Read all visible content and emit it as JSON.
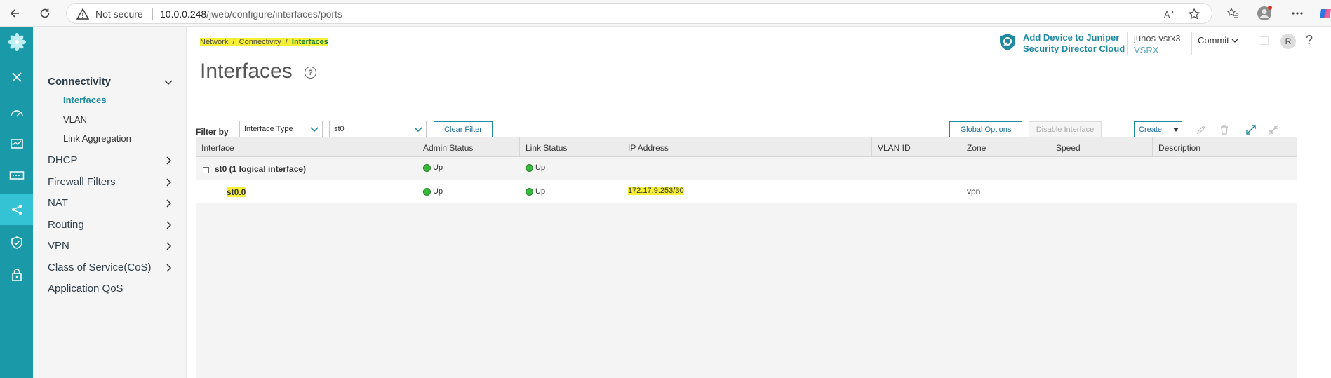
{
  "browser": {
    "security_label": "Not secure",
    "url_host": "10.0.0.248",
    "url_path": "/jweb/configure/interfaces/ports",
    "read_aloud_label": "A̅"
  },
  "rail": {
    "items": [
      {
        "icon": "juniper-logo-icon"
      },
      {
        "icon": "close-icon"
      },
      {
        "icon": "dashboard-icon"
      },
      {
        "icon": "monitor-icon"
      },
      {
        "icon": "device-icon"
      },
      {
        "icon": "network-icon"
      },
      {
        "icon": "security-policies-icon"
      },
      {
        "icon": "lock-icon"
      }
    ]
  },
  "subnav": {
    "items": [
      {
        "label": "Connectivity",
        "expanded": true
      },
      {
        "label": "Interfaces",
        "sub": true,
        "active": true
      },
      {
        "label": "VLAN",
        "sub": true
      },
      {
        "label": "Link Aggregation",
        "sub": true
      },
      {
        "label": "DHCP"
      },
      {
        "label": "Firewall Filters"
      },
      {
        "label": "NAT"
      },
      {
        "label": "Routing"
      },
      {
        "label": "VPN"
      },
      {
        "label": "Class of Service(CoS)"
      },
      {
        "label": "Application QoS"
      }
    ]
  },
  "header": {
    "breadcrumb": [
      "Network",
      "Connectivity",
      "Interfaces"
    ],
    "breadcrumb_sep": "/",
    "title": "Interfaces",
    "help": "?",
    "sd_line1": "Add Device to Juniper",
    "sd_line2": "Security Director Cloud",
    "host_name": "junos-vsrx3",
    "host_model": "VSRX",
    "commit_label": "Commit",
    "avatar_initial": "R",
    "help_label": "?"
  },
  "filter": {
    "label": "Filter by",
    "type_value": "Interface Type",
    "value": "st0",
    "clear_label": "Clear Filter"
  },
  "toolbar": {
    "global_options_label": "Global Options",
    "disable_interface_label": "Disable Interface",
    "create_label": "Create"
  },
  "table": {
    "columns": [
      "Interface",
      "Admin Status",
      "Link Status",
      "IP Address",
      "VLAN ID",
      "Zone",
      "Speed",
      "Description"
    ],
    "group": {
      "name": "st0 (1 logical interface)",
      "admin_status": "Up",
      "link_status": "Up"
    },
    "rows": [
      {
        "interface": "st0.0",
        "admin_status": "Up",
        "link_status": "Up",
        "ip_address": "172.17.9.253/30",
        "vlan_id": "",
        "zone": "vpn",
        "speed": "",
        "description": ""
      }
    ]
  },
  "colors": {
    "rail": "#1a99a8",
    "rail_active": "#33c3d4",
    "accent": "#1e8aa0",
    "highlight": "#f5ef35",
    "status_up": "#36b83a"
  }
}
